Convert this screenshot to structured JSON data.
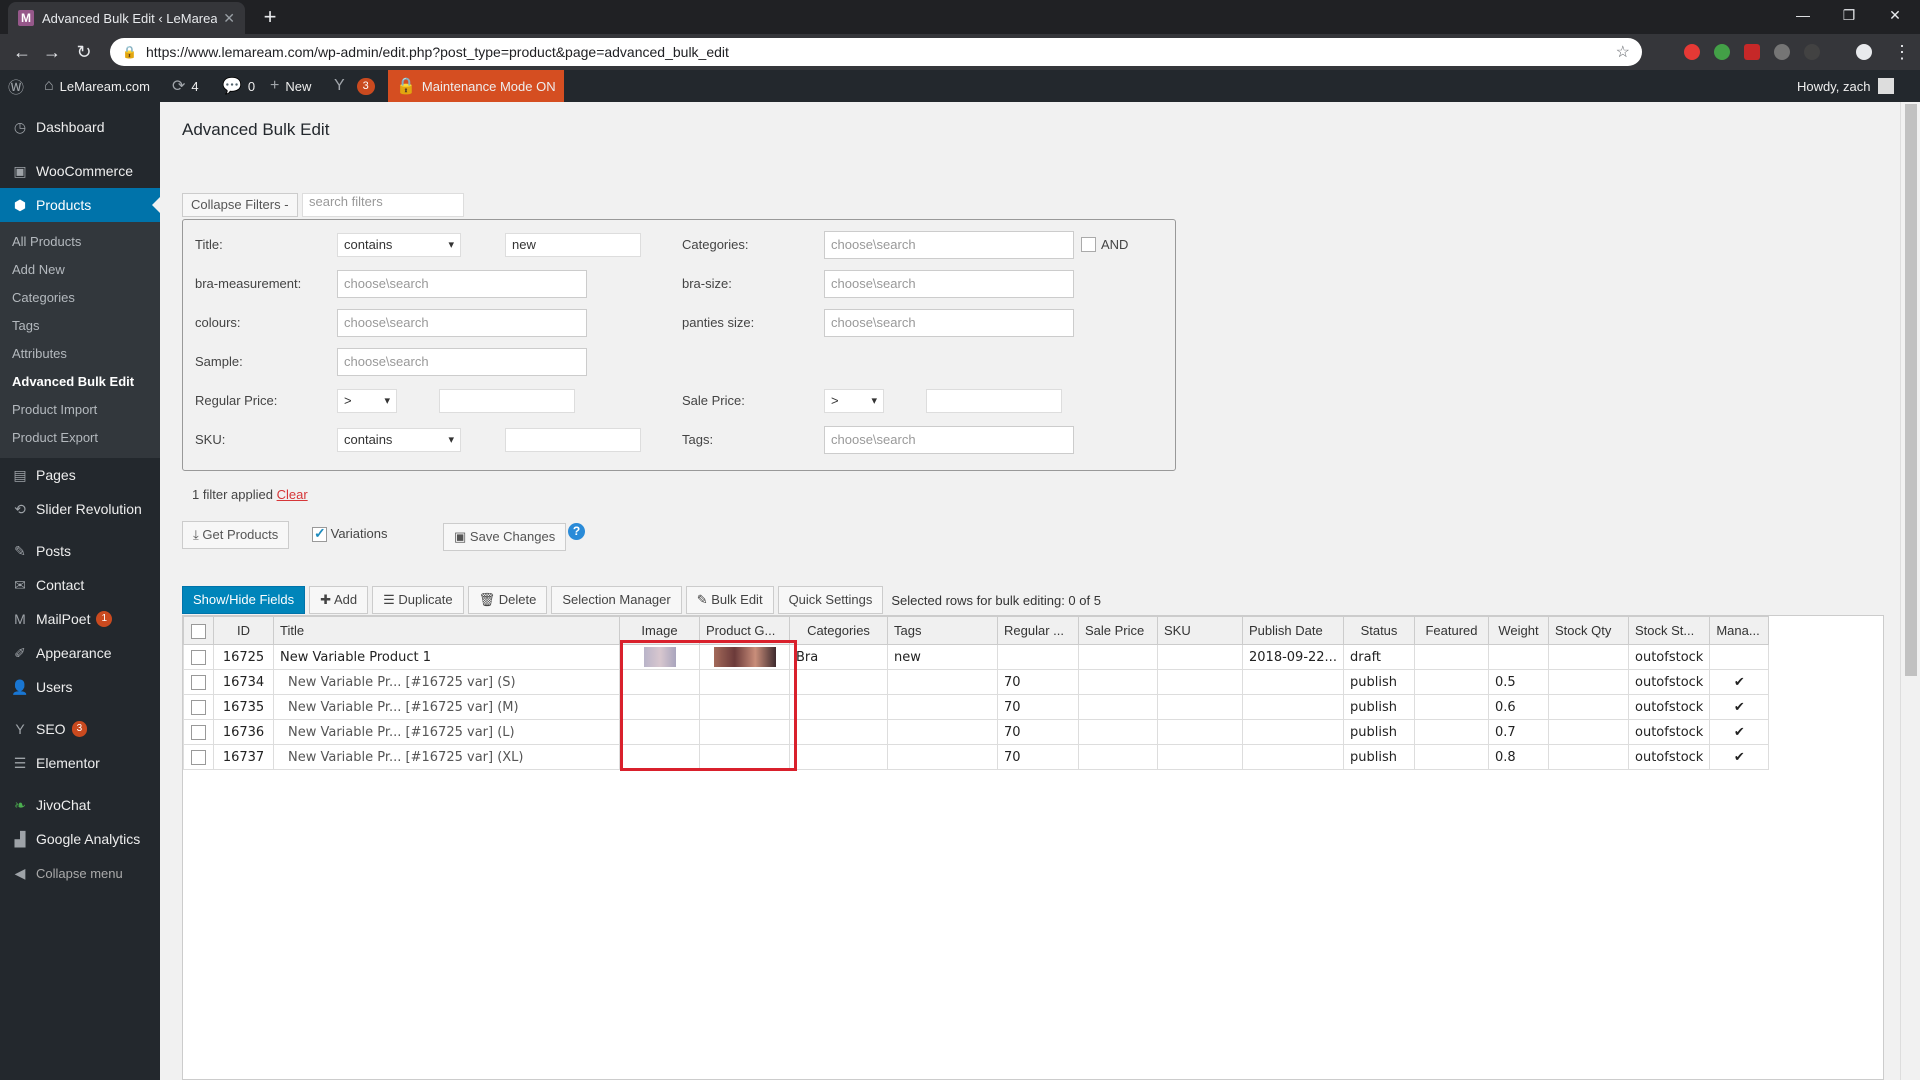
{
  "browser": {
    "tab_title": "Advanced Bulk Edit ‹ LeMaream.c",
    "favicon_letter": "M",
    "url": "https://www.lemaream.com/wp-admin/edit.php?post_type=product&page=advanced_bulk_edit"
  },
  "adminbar": {
    "site_name": "LeMaream.com",
    "updates_count": "4",
    "comments_count": "0",
    "new_label": "New",
    "yoast_count": "3",
    "maintenance_label": "Maintenance Mode ON",
    "howdy": "Howdy, zach"
  },
  "sidebar": {
    "dashboard": "Dashboard",
    "woocommerce": "WooCommerce",
    "products": "Products",
    "submenu": [
      "All Products",
      "Add New",
      "Categories",
      "Tags",
      "Attributes",
      "Advanced Bulk Edit",
      "Product Import",
      "Product Export"
    ],
    "pages": "Pages",
    "slider": "Slider Revolution",
    "posts": "Posts",
    "contact": "Contact",
    "mailpoet": "MailPoet",
    "mailpoet_count": "1",
    "appearance": "Appearance",
    "users": "Users",
    "seo": "SEO",
    "seo_count": "3",
    "elementor": "Elementor",
    "jivochat": "JivoChat",
    "analytics": "Google Analytics",
    "collapse": "Collapse menu"
  },
  "page": {
    "title": "Advanced Bulk Edit",
    "collapse_filters": "Collapse Filters -",
    "search_filters_placeholder": "search filters"
  },
  "filters": {
    "title_label": "Title:",
    "title_op": "contains",
    "title_value": "new",
    "categories_label": "Categories:",
    "choose": "choose\\search",
    "and_label": "AND",
    "bra_measurement_label": "bra-measurement:",
    "bra_size_label": "bra-size:",
    "colours_label": "colours:",
    "panties_size_label": "panties size:",
    "sample_label": "Sample:",
    "regular_price_label": "Regular Price:",
    "regular_price_op": ">",
    "sale_price_label": "Sale Price:",
    "sale_price_op": ">",
    "sku_label": "SKU:",
    "sku_op": "contains",
    "tags_label": "Tags:"
  },
  "applied": {
    "text": "1 filter applied",
    "clear": "Clear"
  },
  "actions": {
    "get_products": "Get Products",
    "variations": "Variations",
    "save_changes": "Save Changes",
    "help": "?"
  },
  "toolbar": {
    "show_hide": "Show/Hide Fields",
    "add": "Add",
    "duplicate": "Duplicate",
    "delete": "Delete",
    "selection_manager": "Selection Manager",
    "bulk_edit": "Bulk Edit",
    "quick_settings": "Quick Settings",
    "selected": "Selected rows for bulk editing:  0 of 5"
  },
  "grid": {
    "columns": [
      "ID",
      "Title",
      "Image",
      "Product G...",
      "Categories",
      "Tags",
      "Regular ...",
      "Sale Price",
      "SKU",
      "Publish Date",
      "Status",
      "Featured",
      "Weight",
      "Stock Qty",
      "Stock St...",
      "Mana..."
    ],
    "rows": [
      {
        "id": "16725",
        "title": "New Variable Product 1",
        "categories": "Bra",
        "tags": "new",
        "regular": "",
        "publish": "2018-09-22...",
        "status": "draft",
        "weight": "",
        "stock_status": "outofstock",
        "managed": ""
      },
      {
        "id": "16734",
        "title": "New Variable Pr... [#16725 var] (S)",
        "categories": "",
        "tags": "",
        "regular": "70",
        "publish": "",
        "status": "publish",
        "weight": "0.5",
        "stock_status": "outofstock",
        "managed": "✔"
      },
      {
        "id": "16735",
        "title": "New Variable Pr... [#16725 var] (M)",
        "categories": "",
        "tags": "",
        "regular": "70",
        "publish": "",
        "status": "publish",
        "weight": "0.6",
        "stock_status": "outofstock",
        "managed": "✔"
      },
      {
        "id": "16736",
        "title": "New Variable Pr... [#16725 var] (L)",
        "categories": "",
        "tags": "",
        "regular": "70",
        "publish": "",
        "status": "publish",
        "weight": "0.7",
        "stock_status": "outofstock",
        "managed": "✔"
      },
      {
        "id": "16737",
        "title": "New Variable Pr... [#16725 var] (XL)",
        "categories": "",
        "tags": "",
        "regular": "70",
        "publish": "",
        "status": "publish",
        "weight": "0.8",
        "stock_status": "outofstock",
        "managed": "✔"
      }
    ]
  },
  "colors": {
    "admin_bar": "#23282d",
    "accent": "#0073aa",
    "maintenance": "#d54e21",
    "highlight": "#d9202c"
  }
}
